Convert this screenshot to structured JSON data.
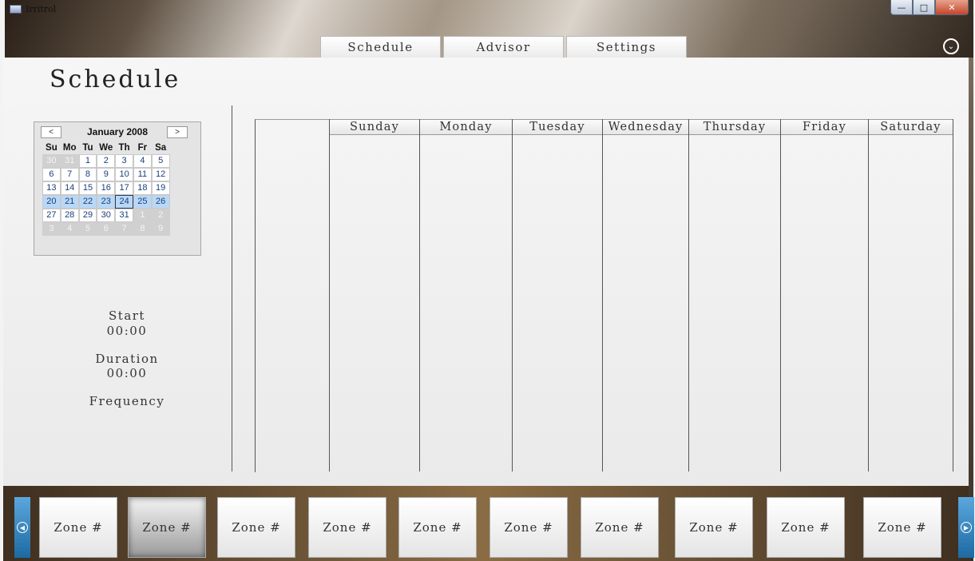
{
  "window": {
    "title": "Irritrol",
    "minimize": "—",
    "maximize": "□",
    "close": "✕"
  },
  "tabs": [
    "Schedule",
    "Advisor",
    "Settings"
  ],
  "page_title": "Schedule",
  "calendar": {
    "month": "January 2008",
    "prev": "<",
    "next": ">",
    "dow": [
      "Su",
      "Mo",
      "Tu",
      "We",
      "Th",
      "Fr",
      "Sa"
    ],
    "days": [
      {
        "d": "30",
        "o": true
      },
      {
        "d": "31",
        "o": true
      },
      {
        "d": "1"
      },
      {
        "d": "2"
      },
      {
        "d": "3"
      },
      {
        "d": "4"
      },
      {
        "d": "5"
      },
      {
        "d": "6"
      },
      {
        "d": "7"
      },
      {
        "d": "8"
      },
      {
        "d": "9"
      },
      {
        "d": "10"
      },
      {
        "d": "11"
      },
      {
        "d": "12"
      },
      {
        "d": "13"
      },
      {
        "d": "14"
      },
      {
        "d": "15"
      },
      {
        "d": "16"
      },
      {
        "d": "17"
      },
      {
        "d": "18"
      },
      {
        "d": "19"
      },
      {
        "d": "20",
        "w": true
      },
      {
        "d": "21",
        "w": true
      },
      {
        "d": "22",
        "w": true
      },
      {
        "d": "23",
        "w": true
      },
      {
        "d": "24",
        "w": true,
        "t": true
      },
      {
        "d": "25",
        "w": true
      },
      {
        "d": "26",
        "w": true
      },
      {
        "d": "27"
      },
      {
        "d": "28"
      },
      {
        "d": "29"
      },
      {
        "d": "30"
      },
      {
        "d": "31"
      },
      {
        "d": "1",
        "o": true
      },
      {
        "d": "2",
        "o": true
      },
      {
        "d": "3",
        "o": true
      },
      {
        "d": "4",
        "o": true
      },
      {
        "d": "5",
        "o": true
      },
      {
        "d": "6",
        "o": true
      },
      {
        "d": "7",
        "o": true
      },
      {
        "d": "8",
        "o": true
      },
      {
        "d": "9",
        "o": true
      }
    ]
  },
  "info": {
    "start_label": "Start",
    "start_value": "00:00",
    "duration_label": "Duration",
    "duration_value": "00:00",
    "frequency_label": "Frequency"
  },
  "days_of_week": [
    "Sunday",
    "Monday",
    "Tuesday",
    "Wednesday",
    "Thursday",
    "Friday",
    "Saturday"
  ],
  "zones": [
    "Zone #",
    "Zone #",
    "Zone #",
    "Zone #",
    "Zone #",
    "Zone #",
    "Zone #",
    "Zone #",
    "Zone #",
    "Zone #"
  ],
  "icons": {
    "menu": "⌄",
    "zone_prev": "◀",
    "zone_next": "▶"
  }
}
